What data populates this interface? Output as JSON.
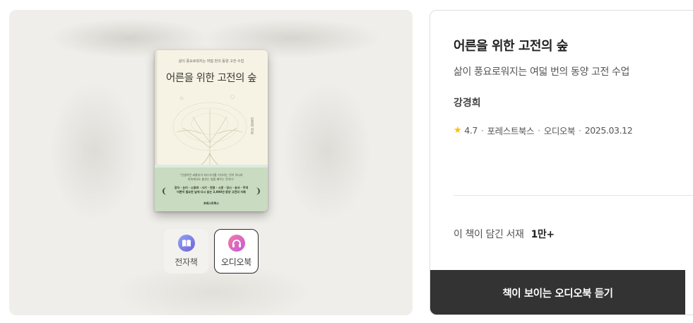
{
  "cover": {
    "subtitle": "삶이 풍요로워지는 여덟 번의 동양 고전 수업",
    "title": "어른을 위한 고전의 숲",
    "author_vertical": "강경희 지음",
    "quote_line1": "“인생이란 씨줄부가 지나가기를 기다리는 것이 아니라",
    "quote_line2": "빗속에서도 춤추는 법을 배우는 것이다”",
    "keywords_line1": "장자 · 논어 · 소동파 · 사기 · 한용 · 시경 · 당시 · 송사 · 주역",
    "keywords_line2": "어른이 필요한 날에 다시 읽는 3,000년 동양 고전의 지혜",
    "laurel_left": "❨",
    "laurel_right": "❩",
    "publisher": "포레스트북스"
  },
  "formats": [
    {
      "label": "전자책",
      "icon": "book-icon",
      "selected": false
    },
    {
      "label": "오디오북",
      "icon": "headphones-icon",
      "selected": true
    }
  ],
  "book": {
    "title": "어른을 위한 고전의 숲",
    "subtitle": "삶이 풍요로워지는 여덟 번의 동양 고전 수업",
    "author": "강경희",
    "rating": "4.7",
    "publisher": "포레스트북스",
    "format": "오디오북",
    "date": "2025.03.12",
    "separator": "·"
  },
  "library": {
    "label": "이 책이 담긴 서재",
    "count": "1만+"
  },
  "cta": {
    "label": "책이 보이는 오디오북 듣기"
  },
  "colors": {
    "cta_bg": "#333333",
    "star": "#f6c400",
    "ebook_icon": "#7a74e2",
    "audio_icon": "#e06aae"
  }
}
